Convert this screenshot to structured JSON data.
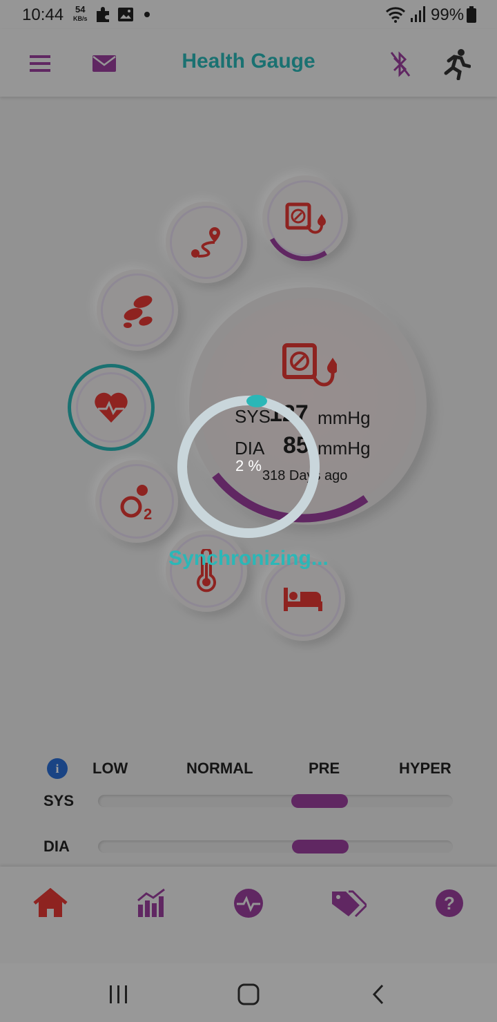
{
  "status_bar": {
    "time": "10:44",
    "net_speed_value": "54",
    "net_speed_unit": "KB/s",
    "battery": "99%"
  },
  "app_bar": {
    "title": "Health Gauge",
    "menu_icon": "hamburger-icon",
    "mail_icon": "mail-icon",
    "bluetooth_icon": "bluetooth-off-icon",
    "activity_icon": "running-person-icon"
  },
  "main_gauge": {
    "sys_label": "SYS",
    "sys_value": "127",
    "dia_label": "DIA",
    "dia_value": "85",
    "unit": "mmHg",
    "timestamp": "318 Days ago"
  },
  "sync": {
    "percent": "2 %",
    "progress": 0.02,
    "label": "Synchronizing..."
  },
  "levels": {
    "headers": [
      "LOW",
      "NORMAL",
      "PRE",
      "HYPER"
    ],
    "rows": [
      {
        "label": "SYS",
        "level": "PRE"
      },
      {
        "label": "DIA",
        "level": "PRE"
      }
    ]
  },
  "bottom_nav": [
    "home-icon",
    "bar-chart-icon",
    "heartbeat-icon",
    "tags-icon",
    "help-icon"
  ],
  "colors": {
    "accent": "#2bb7b7",
    "purple": "#9b3f9f",
    "red": "#e53935",
    "overlay_ring": "#c9d6db"
  }
}
